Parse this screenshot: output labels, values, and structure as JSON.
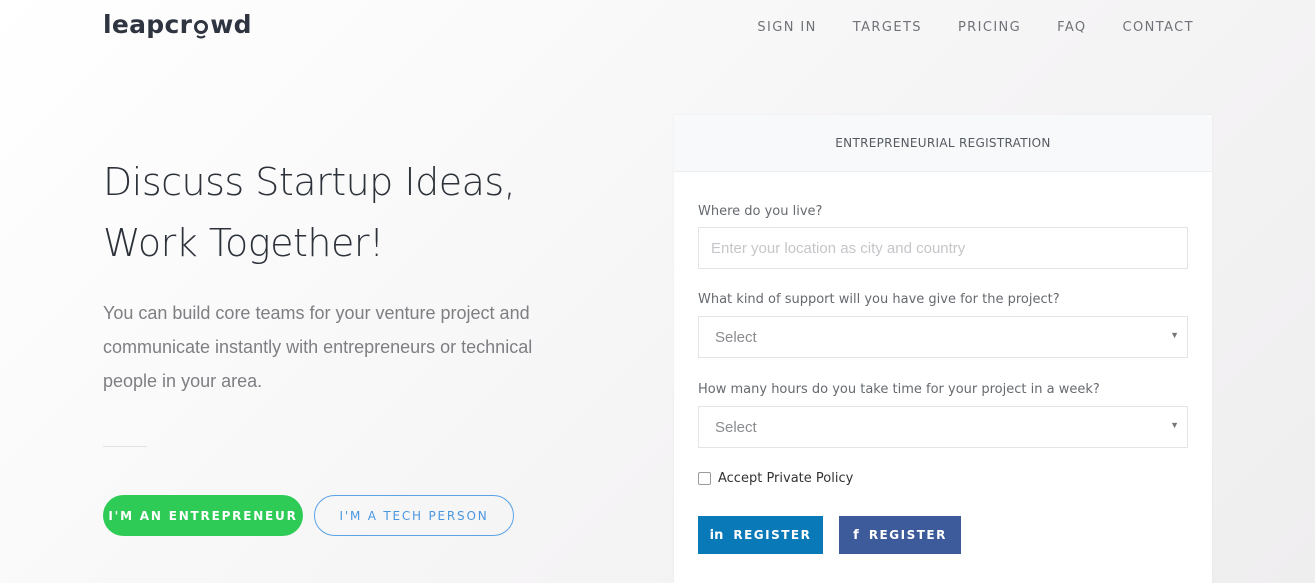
{
  "header": {
    "logo_text_before": "leapcr",
    "logo_text_after": "wd",
    "nav": [
      "SIGN IN",
      "TARGETS",
      "PRICING",
      "FAQ",
      "CONTACT"
    ]
  },
  "hero": {
    "title_line1": "Discuss Startup Ideas,",
    "title_line2": "Work Together!",
    "description": "You can build core teams for your venture project and communicate instantly with entrepreneurs or technical people in your area.",
    "entrepreneur_button": "I'M AN ENTREPRENEUR",
    "tech_button": "I'M A TECH PERSON"
  },
  "form": {
    "header": "ENTREPRENEURIAL REGISTRATION",
    "location_label": "Where do you live?",
    "location_placeholder": "Enter your location as city and country",
    "support_label": "What kind of support will you have give for the project?",
    "support_value": "Select",
    "hours_label": "How many hours do you take time for your project in a week?",
    "hours_value": "Select",
    "policy_label": "Accept Private Policy",
    "linkedin_button": "REGISTER",
    "facebook_button": "REGISTER"
  },
  "colors": {
    "green": "#2ecb57",
    "blue_outline": "#5aa3e6",
    "linkedin": "#0a79b8",
    "facebook": "#3d5a9a"
  }
}
